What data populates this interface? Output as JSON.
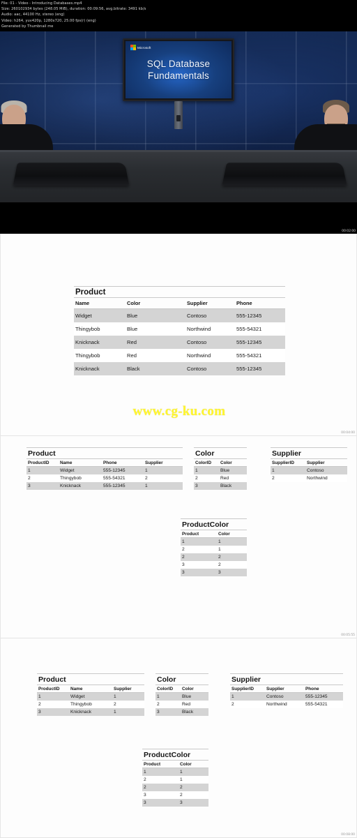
{
  "header": {
    "lines": [
      "File: 01 - Video - Introducing Databases.mp4",
      "Size: 260102934 bytes (248.05 MiB), duration: 00:09:56, avg.bitrate: 3491 kb/s",
      "Audio: aac, 44100 Hz, stereo (eng)",
      "Video: h264, yuv420p, 1280x720, 25.00 fps(r) (eng)",
      "Generated by Thumbnail me"
    ]
  },
  "frames": [
    {
      "type": "video",
      "timestamp": "00:02:00",
      "slide": {
        "brand": "Microsoft",
        "title_line1": "SQL Database",
        "title_line2": "Fundamentals"
      }
    },
    {
      "type": "slide",
      "timestamp": "00:04:00",
      "watermark": "www.cg-ku.com",
      "tables": [
        {
          "title": "Product",
          "columns": [
            "Name",
            "Color",
            "Supplier",
            "Phone"
          ],
          "rows": [
            [
              "Widget",
              "Blue",
              "Contoso",
              "555-12345"
            ],
            [
              "Thingybob",
              "Blue",
              "Northwind",
              "555-54321"
            ],
            [
              "Knicknack",
              "Red",
              "Contoso",
              "555-12345"
            ],
            [
              "Thingybob",
              "Red",
              "Northwind",
              "555-54321"
            ],
            [
              "Knicknack",
              "Black",
              "Contoso",
              "555-12345"
            ]
          ]
        }
      ]
    },
    {
      "type": "slide",
      "timestamp": "00:05:55",
      "tables": [
        {
          "title": "Product",
          "columns": [
            "ProductID",
            "Name",
            "Phone",
            "Supplier"
          ],
          "rows": [
            [
              "1",
              "Widget",
              "555-12345",
              "1"
            ],
            [
              "2",
              "Thingybob",
              "555-54321",
              "2"
            ],
            [
              "3",
              "Knicknack",
              "555-12345",
              "1"
            ]
          ]
        },
        {
          "title": "Color",
          "columns": [
            "ColorID",
            "Color"
          ],
          "rows": [
            [
              "1",
              "Blue"
            ],
            [
              "2",
              "Red"
            ],
            [
              "3",
              "Black"
            ]
          ]
        },
        {
          "title": "Supplier",
          "columns": [
            "SupplierID",
            "Supplier"
          ],
          "rows": [
            [
              "1",
              "Contoso"
            ],
            [
              "2",
              "Northwind"
            ]
          ]
        },
        {
          "title": "ProductColor",
          "columns": [
            "Product",
            "Color"
          ],
          "rows": [
            [
              "1",
              "1"
            ],
            [
              "2",
              "1"
            ],
            [
              "2",
              "2"
            ],
            [
              "3",
              "2"
            ],
            [
              "3",
              "3"
            ]
          ]
        }
      ]
    },
    {
      "type": "slide",
      "timestamp": "00:08:00",
      "tables": [
        {
          "title": "Product",
          "columns": [
            "ProductID",
            "Name",
            "Supplier"
          ],
          "rows": [
            [
              "1",
              "Widget",
              "1"
            ],
            [
              "2",
              "Thingybob",
              "2"
            ],
            [
              "3",
              "Knicknack",
              "1"
            ]
          ]
        },
        {
          "title": "Color",
          "columns": [
            "ColorID",
            "Color"
          ],
          "rows": [
            [
              "1",
              "Blue"
            ],
            [
              "2",
              "Red"
            ],
            [
              "3",
              "Black"
            ]
          ]
        },
        {
          "title": "Supplier",
          "columns": [
            "SupplierID",
            "Supplier",
            "Phone"
          ],
          "rows": [
            [
              "1",
              "Contoso",
              "555-12345"
            ],
            [
              "2",
              "Northwind",
              "555-54321"
            ]
          ]
        },
        {
          "title": "ProductColor",
          "columns": [
            "Product",
            "Color"
          ],
          "rows": [
            [
              "1",
              "1"
            ],
            [
              "2",
              "1"
            ],
            [
              "2",
              "2"
            ],
            [
              "3",
              "2"
            ],
            [
              "3",
              "3"
            ]
          ]
        }
      ]
    }
  ]
}
